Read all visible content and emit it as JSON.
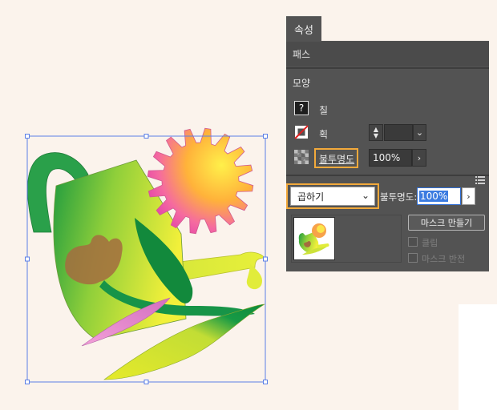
{
  "panel": {
    "tab_label": "속성",
    "section_path": "패스",
    "section_appearance": "모양",
    "fill_label": "칠",
    "stroke_label": "획",
    "opacity_label": "불투명도",
    "opacity_value": "100%",
    "fill_icon_glyph": "?"
  },
  "transparency": {
    "blend_mode": "곱하기",
    "opacity_label": "불투명도:",
    "opacity_value": "100%",
    "make_mask_label": "마스크 만들기",
    "clip_label": "클립",
    "invert_mask_label": "마스크 반전",
    "clip_checked": false,
    "invert_checked": false
  },
  "colors": {
    "panel_bg": "#535353",
    "highlight": "#f2a93b",
    "selection": "#5b7fe6"
  }
}
